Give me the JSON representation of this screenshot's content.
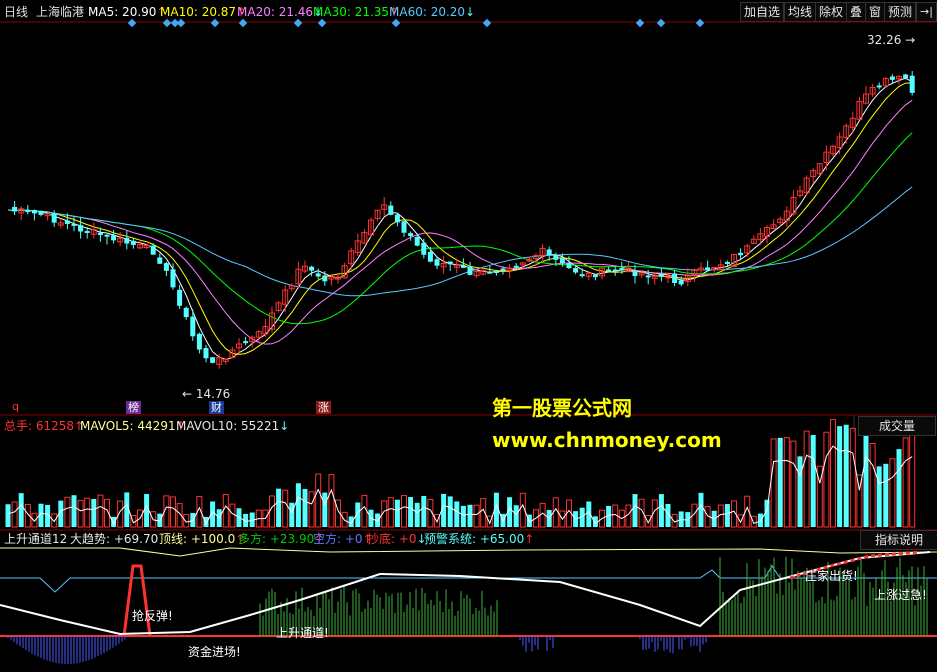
{
  "header": {
    "period": "日线",
    "stock": "上海临港",
    "ma5": "MA5: 20.90",
    "ma5_arrow": "↑",
    "ma10": "MA10: 20.87",
    "ma10_arrow": "↑",
    "ma20": "MA20: 21.46",
    "ma20_arrow": "↓",
    "ma30": "MA30: 21.35",
    "ma30_arrow": "↑",
    "ma60": "MA60: 20.20",
    "ma60_arrow": "↓",
    "buttons": [
      "加自选",
      "均线",
      "除权",
      "叠",
      "窗",
      "预测"
    ],
    "exit_icon": "→|"
  },
  "price_panel": {
    "high_label": "32.26",
    "low_label": "14.76",
    "marker_q": "q",
    "marker_rank": "榜",
    "marker_fin": "财",
    "marker_limit": "涨"
  },
  "watermark": {
    "line1": "第一股票公式网",
    "line2": "www.chnmoney.com"
  },
  "volume_panel": {
    "total": "总手: 61258",
    "total_arrow": "↑",
    "mavol5": "MAVOL5: 44291",
    "mavol5_arrow": "↑",
    "mavol10": "MAVOL10: 55221",
    "mavol10_arrow": "↓",
    "button": "成交量"
  },
  "indicator_panel": {
    "name": "上升通道12",
    "trend": "大趋势: +69.70",
    "top": "顶线: +100.0",
    "top_arrow": "↑",
    "long": "多方: +23.90",
    "long_arrow": "↑",
    "short": "空方: +0",
    "short_arrow": "↑",
    "bottom": "抄底: +0",
    "bottom_arrow": "↓",
    "warn": "预警系统: +65.00",
    "warn_arrow": "↑",
    "button": "指标说明",
    "ann_rebound": "抢反弹!",
    "ann_capital": "资金进场!",
    "ann_channel": "上升通道!",
    "ann_dealer": "庄家出货!",
    "ann_overheat": "上涨过急!"
  },
  "colors": {
    "up": "#ff3232",
    "down": "#54ffff",
    "ma5": "#ffffff",
    "ma10": "#ffff00",
    "ma20": "#ff80ff",
    "ma30": "#00ff00",
    "ma60": "#5ac8ff",
    "grid": "#8b0000"
  }
}
